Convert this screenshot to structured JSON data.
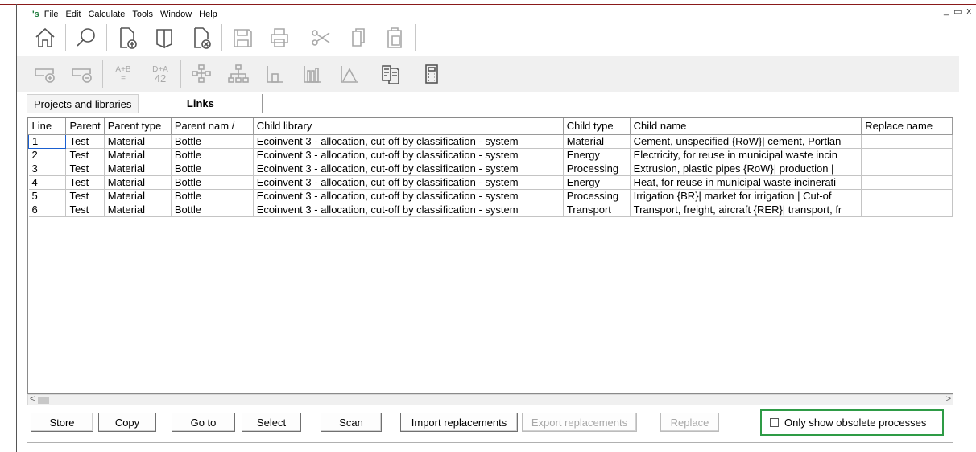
{
  "menu": {
    "logo": "'s",
    "items": [
      {
        "pre": "",
        "ul": "F",
        "post": "ile"
      },
      {
        "pre": "",
        "ul": "E",
        "post": "dit"
      },
      {
        "pre": "",
        "ul": "C",
        "post": "alculate"
      },
      {
        "pre": "",
        "ul": "T",
        "post": "ools"
      },
      {
        "pre": "",
        "ul": "W",
        "post": "indow"
      },
      {
        "pre": "",
        "ul": "H",
        "post": "elp"
      }
    ],
    "window_controls": [
      "_",
      "ᵅ",
      "x"
    ]
  },
  "toolbar2_text": {
    "compare_top": "A+B",
    "compare_bottom": "=",
    "diff_top": "D+A",
    "diff_bottom": "42"
  },
  "tabs": [
    {
      "label": "Projects and libraries"
    },
    {
      "label": "Links"
    }
  ],
  "table": {
    "columns": [
      "Line",
      "Parent",
      "Parent type",
      "Parent nam /",
      "Child library",
      "Child type",
      "Child name",
      "Replace name"
    ],
    "rows": [
      [
        "1",
        "Test",
        "Material",
        "Bottle",
        "Ecoinvent 3 - allocation, cut-off by classification - system",
        "Material",
        "Cement, unspecified {RoW}| cement, Portlan",
        ""
      ],
      [
        "2",
        "Test",
        "Material",
        "Bottle",
        "Ecoinvent 3 - allocation, cut-off by classification - system",
        "Energy",
        "Electricity, for reuse in municipal waste incin",
        ""
      ],
      [
        "3",
        "Test",
        "Material",
        "Bottle",
        "Ecoinvent 3 - allocation, cut-off by classification - system",
        "Processing",
        "Extrusion, plastic pipes {RoW}| production |",
        ""
      ],
      [
        "4",
        "Test",
        "Material",
        "Bottle",
        "Ecoinvent 3 - allocation, cut-off by classification - system",
        "Energy",
        "Heat, for reuse in municipal waste incinerati",
        ""
      ],
      [
        "5",
        "Test",
        "Material",
        "Bottle",
        "Ecoinvent 3 - allocation, cut-off by classification - system",
        "Processing",
        "Irrigation {BR}| market for irrigation | Cut-of",
        ""
      ],
      [
        "6",
        "Test",
        "Material",
        "Bottle",
        "Ecoinvent 3 - allocation, cut-off by classification - system",
        "Transport",
        "Transport, freight, aircraft {RER}| transport, fr",
        ""
      ]
    ]
  },
  "buttons": {
    "store": "Store",
    "copy": "Copy",
    "goto": "Go to",
    "select": "Select",
    "scan": "Scan",
    "import": "Import replacements",
    "export": "Export replacements",
    "replace": "Replace"
  },
  "checkbox": {
    "label": "Only show obsolete processes",
    "checked": false
  },
  "colors": {
    "highlight_border": "#2e9b46",
    "selection_border": "#1a5fd0"
  }
}
